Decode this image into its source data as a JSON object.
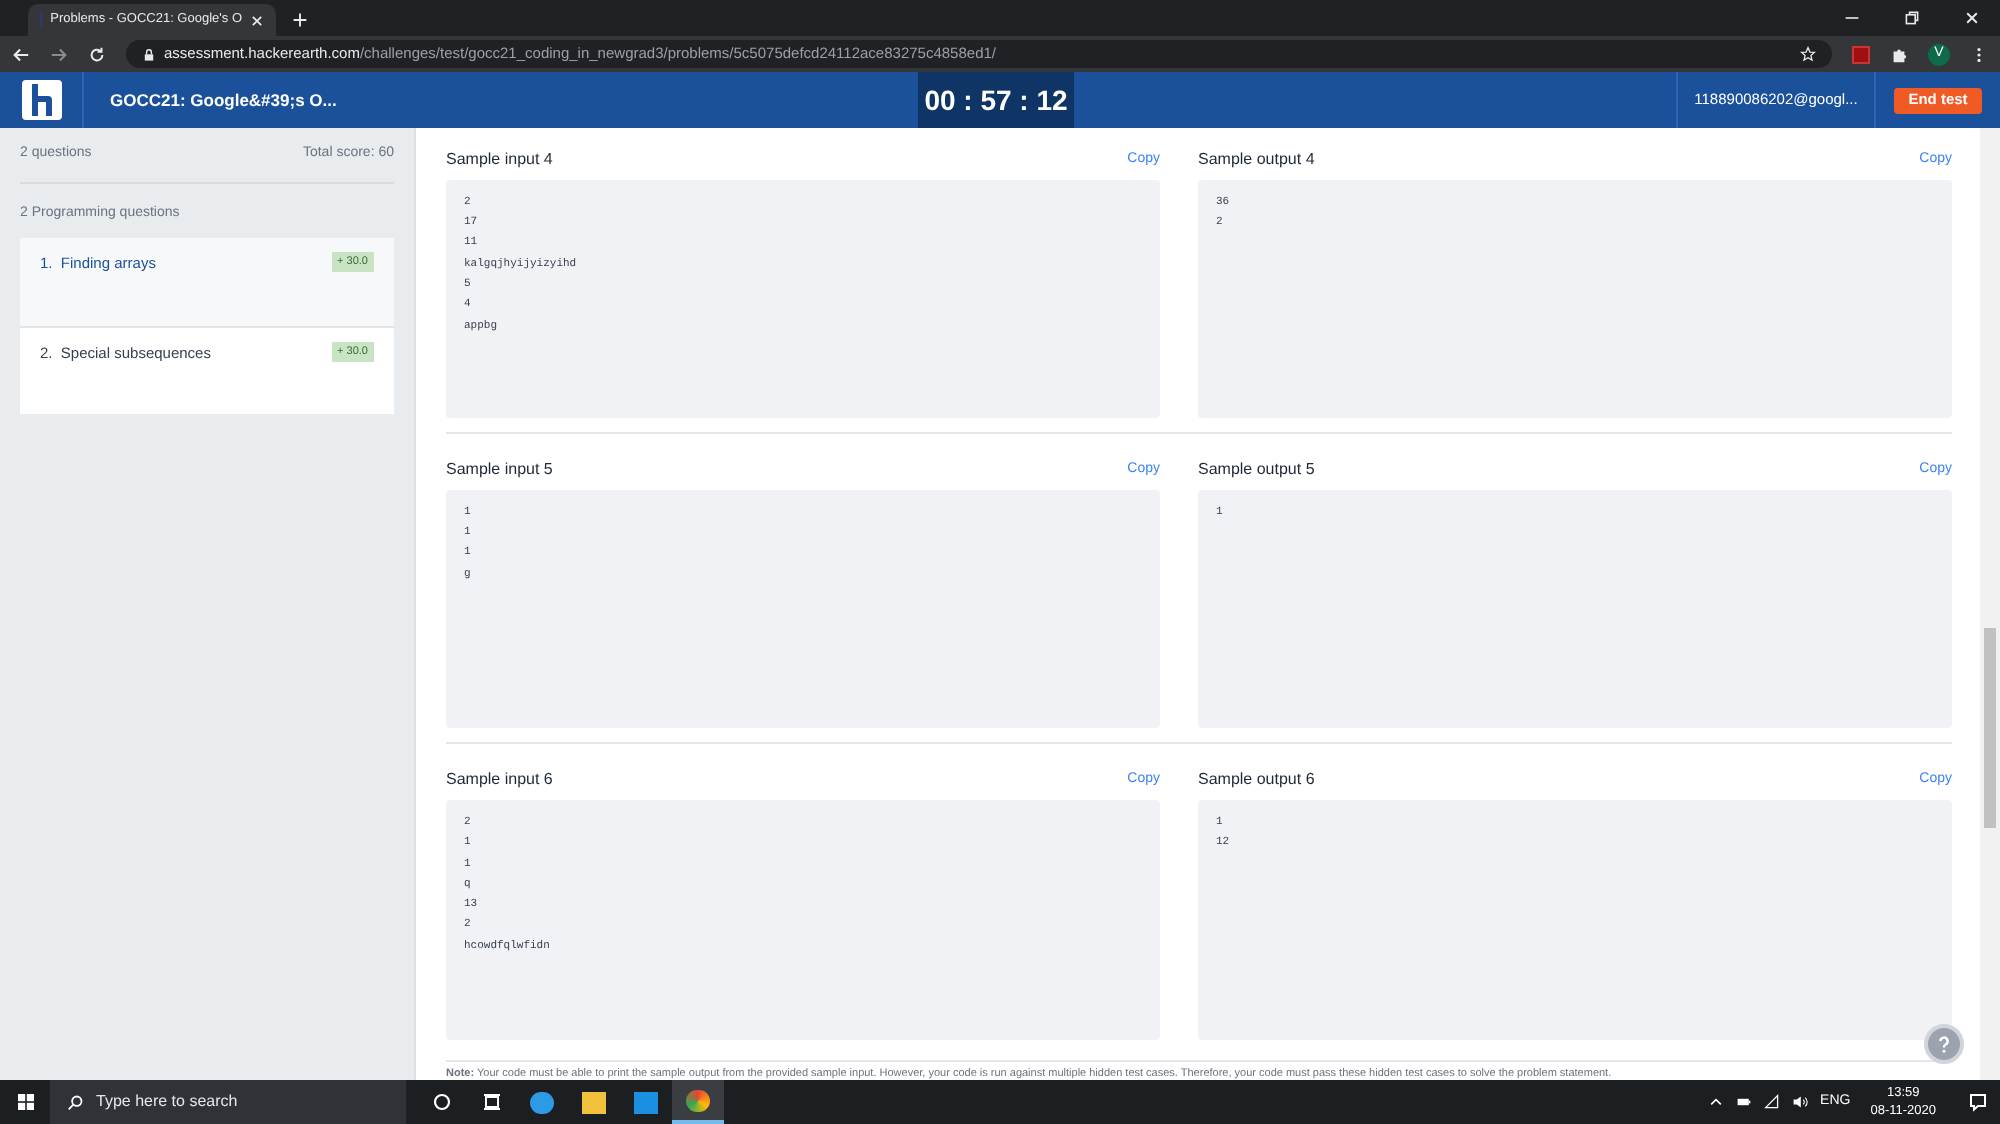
{
  "browser": {
    "tab_title": "Problems - GOCC21: Google's O",
    "url_domain": "assessment.hackerearth.com",
    "url_path": "/challenges/test/gocc21_coding_in_newgrad3/problems/5c5075defcd24112ace83275c4858ed1/",
    "avatar": "V"
  },
  "header": {
    "title": "GOCC21: Google&#39;s O...",
    "timer": "00 : 57 : 12",
    "user": "118890086202@googl...",
    "end_button": "End test"
  },
  "sidebar": {
    "count": "2 questions",
    "total": "Total score: 60",
    "section": "2 Programming questions",
    "questions": [
      {
        "number": "1.",
        "title": "Finding arrays",
        "score": "+ 30.0",
        "selected": true
      },
      {
        "number": "2.",
        "title": "Special subsequences",
        "score": "+ 30.0",
        "selected": false
      }
    ]
  },
  "samples": [
    {
      "input": {
        "title": "Sample input 4",
        "copy": "Copy",
        "lines": [
          "2",
          "17",
          "11",
          "kalgqjhyijyizyihd",
          "5",
          "4",
          "appbg"
        ]
      },
      "output": {
        "title": "Sample output 4",
        "copy": "Copy",
        "lines": [
          "36",
          "2"
        ]
      }
    },
    {
      "input": {
        "title": "Sample input 5",
        "copy": "Copy",
        "lines": [
          "1",
          "1",
          "1",
          "g"
        ]
      },
      "output": {
        "title": "Sample output 5",
        "copy": "Copy",
        "lines": [
          "1"
        ]
      }
    },
    {
      "input": {
        "title": "Sample input 6",
        "copy": "Copy",
        "lines": [
          "2",
          "1",
          "1",
          "q",
          "13",
          "2",
          "hcowdfqlwfidn"
        ]
      },
      "output": {
        "title": "Sample output 6",
        "copy": "Copy",
        "lines": [
          "1",
          "12"
        ]
      }
    }
  ],
  "note": "**Note:** Your code must be able to print the sample output from the provided sample input. However, your code is run against multiple hidden test cases. Therefore, your code must pass these hidden test cases to solve the problem statement.",
  "taskbar": {
    "search_placeholder": "Type here to search",
    "language": "ENG",
    "time": "13:59",
    "date": "08-11-2020"
  }
}
